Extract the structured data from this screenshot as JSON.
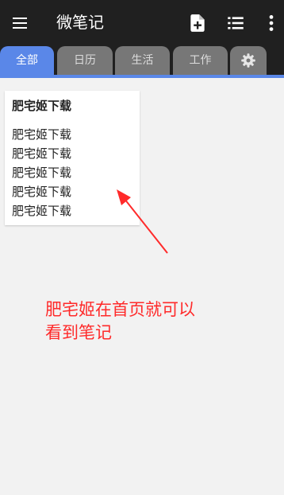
{
  "app": {
    "title": "微笔记"
  },
  "toolbar": {
    "menu_icon": "hamburger-menu-icon",
    "add_note_icon": "add-note-icon",
    "list_icon": "list-view-icon",
    "overflow_icon": "overflow-menu-icon"
  },
  "tabs": [
    {
      "label": "全部",
      "active": true
    },
    {
      "label": "日历",
      "active": false
    },
    {
      "label": "生活",
      "active": false
    },
    {
      "label": "工作",
      "active": false
    },
    {
      "label": "",
      "icon": "settings-gear-icon",
      "active": false
    }
  ],
  "note": {
    "title": "肥宅姬下载",
    "lines": [
      "肥宅姬下载",
      "肥宅姬下载",
      "肥宅姬下载",
      "肥宅姬下载",
      "肥宅姬下载"
    ]
  },
  "annotation": {
    "line1": "肥宅姬在首页就可以",
    "line2": "看到笔记"
  },
  "colors": {
    "app_bar": "#202020",
    "tab_active": "#5a87e8",
    "tab_inactive": "#777777",
    "background": "#f2f2f2",
    "annotation": "#ff2a2a"
  }
}
